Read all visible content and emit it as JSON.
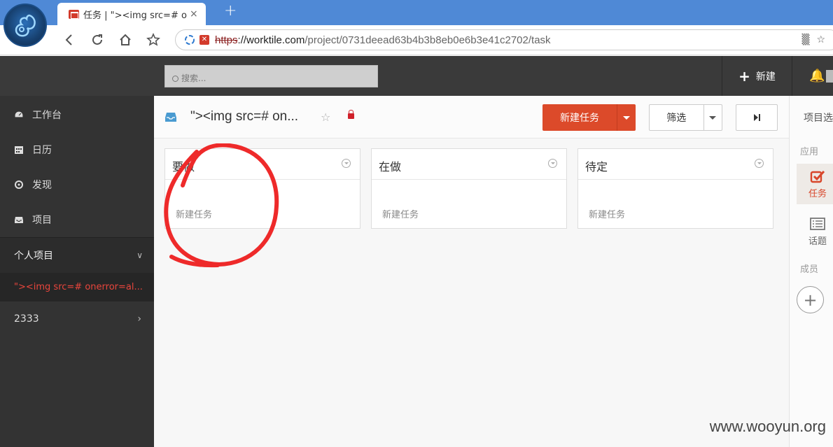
{
  "browser": {
    "tab_title": "任务 | \"><img src=# one",
    "tab_close": "×",
    "new_tab": "+",
    "url_scheme": "https",
    "url_host": "://worktile.com",
    "url_path": "/project/0731deead63b4b3b8eb0e6b3e41c2702/task"
  },
  "header": {
    "search_placeholder": "搜索...",
    "new_button": "新建"
  },
  "sidebar": {
    "items": [
      {
        "label": "工作台",
        "icon": "dashboard-icon"
      },
      {
        "label": "日历",
        "icon": "calendar-icon"
      },
      {
        "label": "发现",
        "icon": "compass-icon"
      },
      {
        "label": "项目",
        "icon": "inbox-icon"
      }
    ],
    "group_label": "个人项目",
    "active_project": "\"><img src=# onerror=al...",
    "sub_group": "2333"
  },
  "project": {
    "title": "\"><img src=# on...",
    "new_task_button": "新建任务",
    "filter_button": "筛选"
  },
  "columns": [
    {
      "title": "要做",
      "add_label": "新建任务"
    },
    {
      "title": "在做",
      "add_label": "新建任务"
    },
    {
      "title": "待定",
      "add_label": "新建任务"
    }
  ],
  "right_panel": {
    "title": "项目选",
    "apps_label": "应用",
    "tab_tasks": "任务",
    "tab_topics": "话题",
    "members_label": "成员",
    "add_member": "+"
  },
  "watermark": "www.wooyun.org",
  "colors": {
    "accent": "#dc4a2a",
    "header_bg": "#3a3a3a",
    "sidebar_bg": "#333333",
    "browser_bar": "#4f89d6",
    "annotation": "#ee2a2a"
  }
}
